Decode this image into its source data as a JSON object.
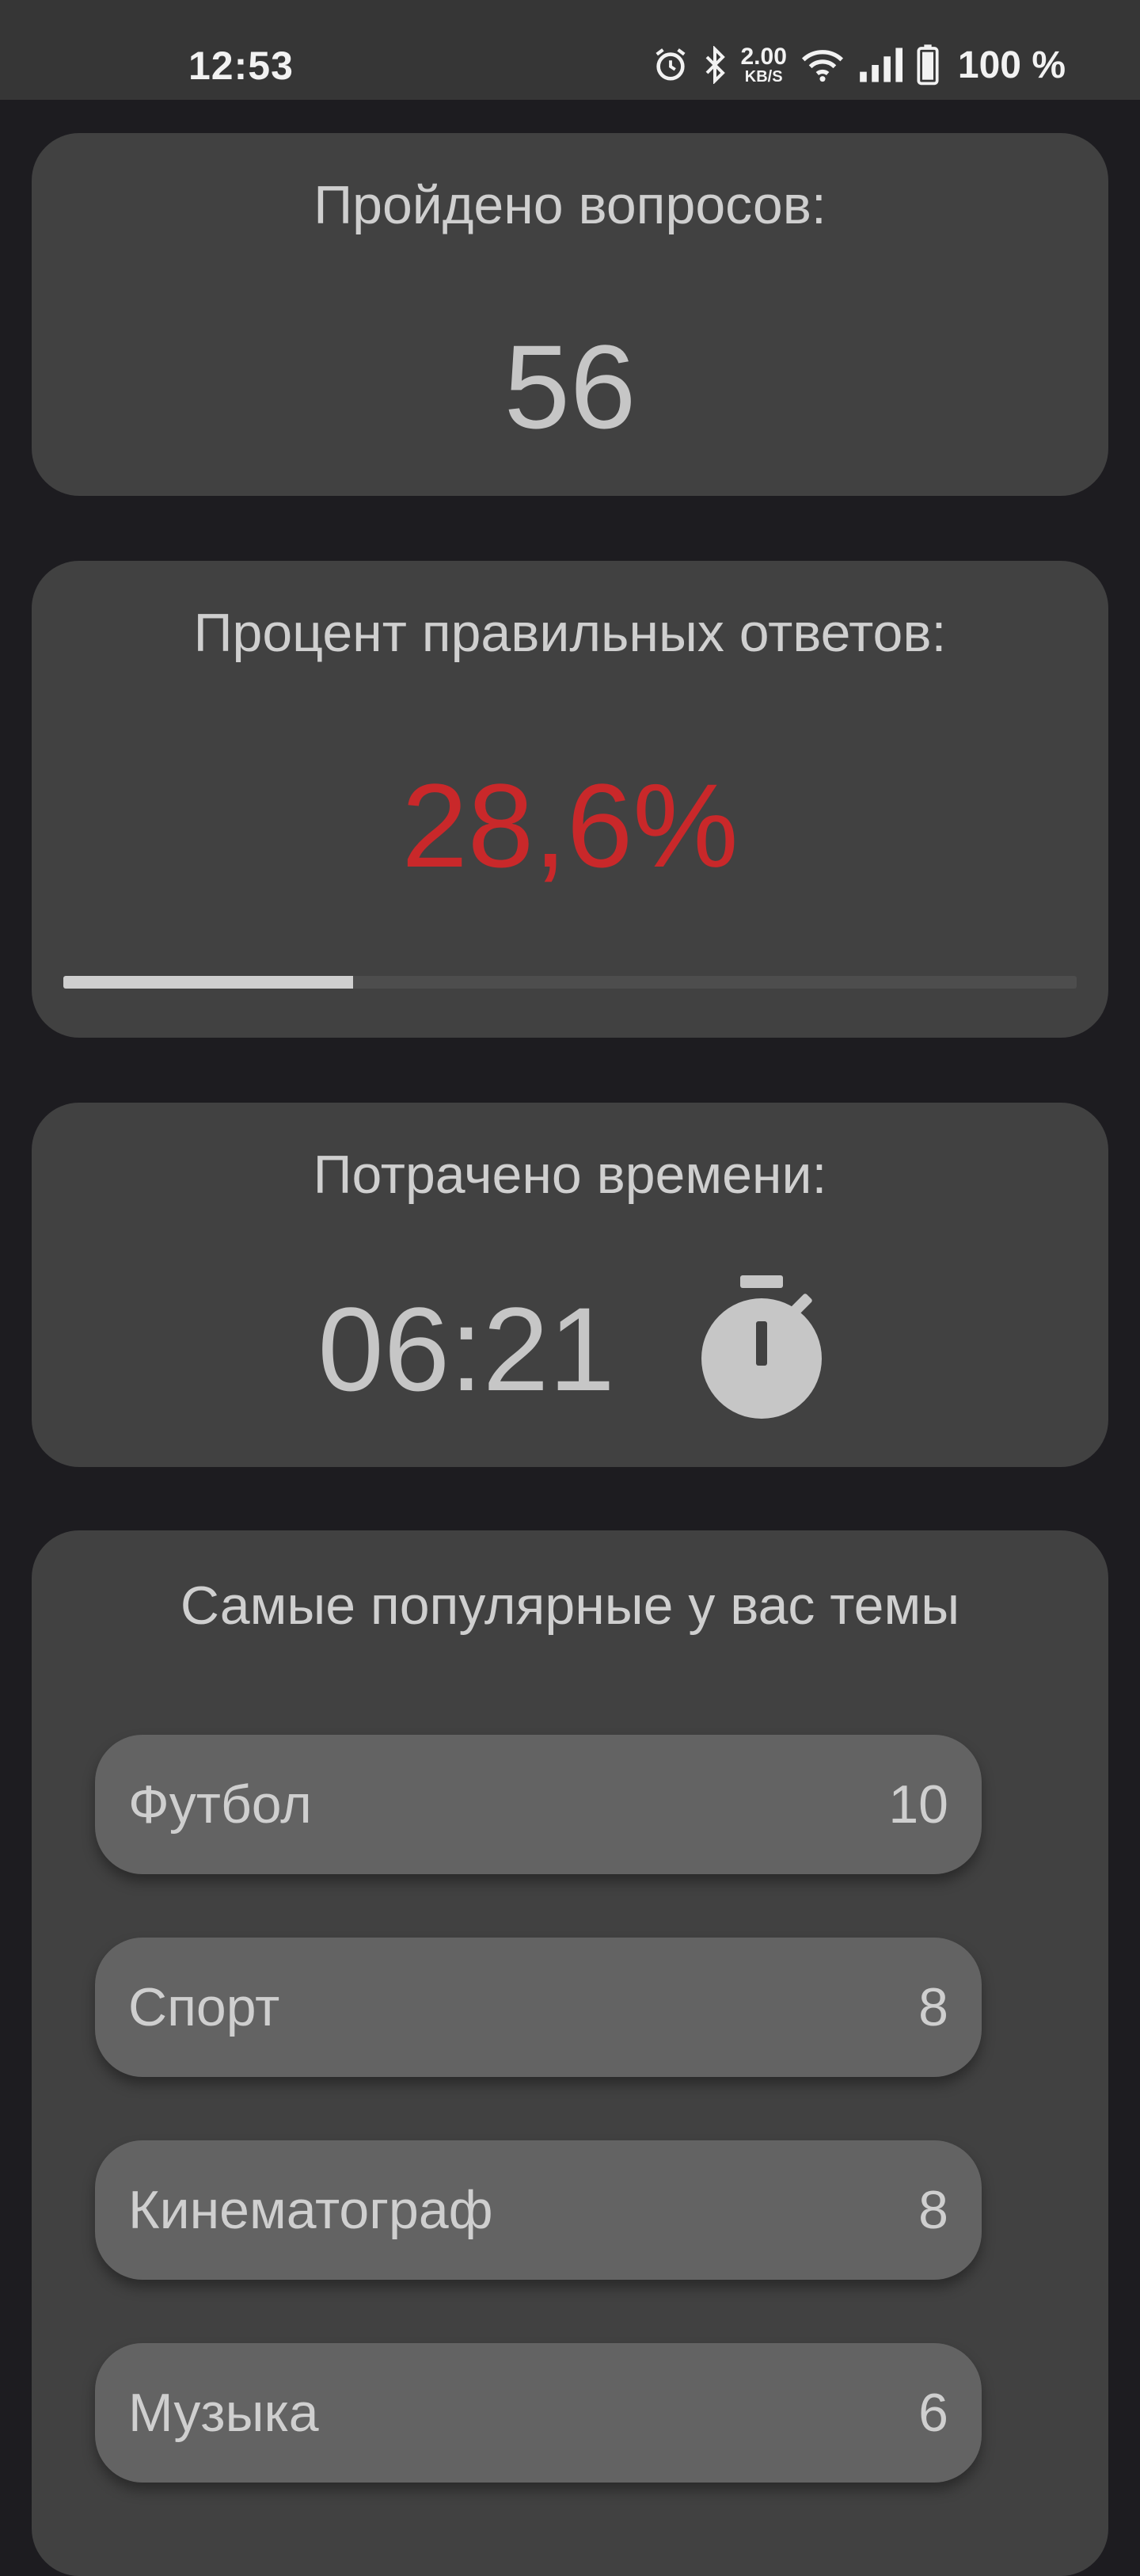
{
  "status_bar": {
    "time": "12:53",
    "net_speed_value": "2.00",
    "net_speed_unit": "KB/S",
    "battery_percent": "100 %",
    "icons": [
      "alarm-icon",
      "bluetooth-icon",
      "wifi-icon",
      "signal-icon",
      "battery-icon"
    ]
  },
  "questions_card": {
    "title": "Пройдено вопросов:",
    "value": "56"
  },
  "accuracy_card": {
    "title": "Процент правильных ответов:",
    "value": "28,6%",
    "progress": 0.286,
    "value_color": "#c9282a"
  },
  "time_card": {
    "title": "Потрачено времени:",
    "value": "06:21",
    "icon": "stopwatch-icon"
  },
  "topics_card": {
    "title": "Самые популярные у вас темы",
    "items": [
      {
        "name": "Футбол",
        "count": "10"
      },
      {
        "name": "Спорт",
        "count": "8"
      },
      {
        "name": "Кинематограф",
        "count": "8"
      },
      {
        "name": "Музыка",
        "count": "6"
      }
    ]
  }
}
